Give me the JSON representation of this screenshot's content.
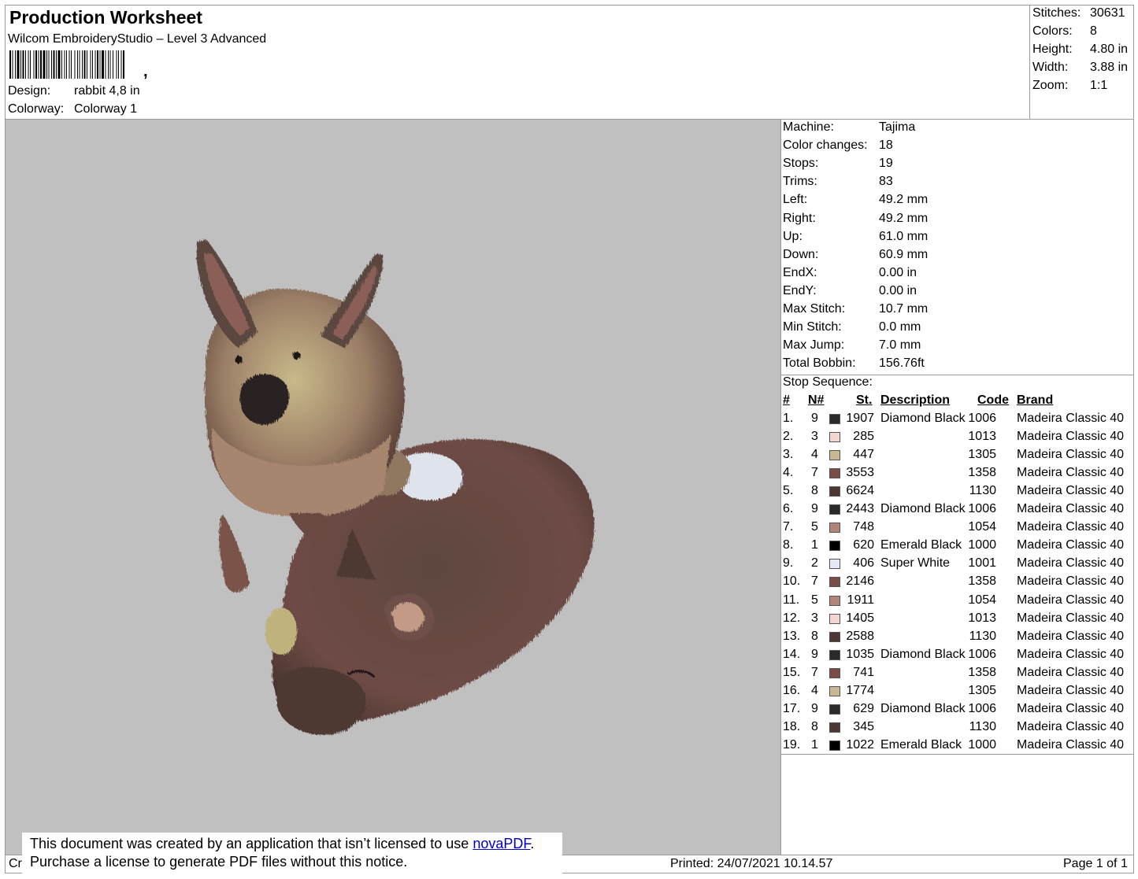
{
  "header": {
    "title": "Production Worksheet",
    "software": "Wilcom EmbroideryStudio – Level 3 Advanced",
    "barcode_suffix": ",",
    "design_label": "Design:",
    "design_value": "rabbit 4,8 in",
    "colorway_label": "Colorway:",
    "colorway_value": "Colorway 1"
  },
  "summary": [
    {
      "label": "Stitches:",
      "value": "30631"
    },
    {
      "label": "Colors:",
      "value": "8"
    },
    {
      "label": "Height:",
      "value": "4.80 in"
    },
    {
      "label": "Width:",
      "value": "3.88 in"
    },
    {
      "label": "Zoom:",
      "value": "1:1"
    }
  ],
  "machine_info": [
    {
      "label": "Machine:",
      "value": "Tajima"
    },
    {
      "label": "Color changes:",
      "value": "18"
    },
    {
      "label": "Stops:",
      "value": "19"
    },
    {
      "label": "Trims:",
      "value": "83"
    },
    {
      "label": "Left:",
      "value": "49.2 mm"
    },
    {
      "label": "Right:",
      "value": "49.2 mm"
    },
    {
      "label": "Up:",
      "value": "61.0 mm"
    },
    {
      "label": "Down:",
      "value": "60.9 mm"
    },
    {
      "label": "EndX:",
      "value": "0.00 in"
    },
    {
      "label": "EndY:",
      "value": "0.00 in"
    },
    {
      "label": "Max Stitch:",
      "value": "10.7 mm"
    },
    {
      "label": "Min Stitch:",
      "value": "0.0 mm"
    },
    {
      "label": "Max Jump:",
      "value": "7.0 mm"
    },
    {
      "label": "Total Bobbin:",
      "value": "156.76ft"
    }
  ],
  "stop_sequence": {
    "title": "Stop Sequence:",
    "headers": {
      "idx": "#",
      "n": "N#",
      "st": "St.",
      "desc": "Description",
      "code": "Code",
      "brand": "Brand"
    },
    "rows": [
      {
        "idx": "1.",
        "n": "9",
        "color": "#2a2a2a",
        "st": "1907",
        "desc": "Diamond Black",
        "code": "1006",
        "brand": "Madeira Classic 40"
      },
      {
        "idx": "2.",
        "n": "3",
        "color": "#f2d6cf",
        "st": "285",
        "desc": "",
        "code": "1013",
        "brand": "Madeira Classic 40"
      },
      {
        "idx": "3.",
        "n": "4",
        "color": "#c8b994",
        "st": "447",
        "desc": "",
        "code": "1305",
        "brand": "Madeira Classic 40"
      },
      {
        "idx": "4.",
        "n": "7",
        "color": "#7a4d47",
        "st": "3553",
        "desc": "",
        "code": "1358",
        "brand": "Madeira Classic 40"
      },
      {
        "idx": "5.",
        "n": "8",
        "color": "#4e3633",
        "st": "6624",
        "desc": "",
        "code": "1130",
        "brand": "Madeira Classic 40"
      },
      {
        "idx": "6.",
        "n": "9",
        "color": "#2a2a2a",
        "st": "2443",
        "desc": "Diamond Black",
        "code": "1006",
        "brand": "Madeira Classic 40"
      },
      {
        "idx": "7.",
        "n": "5",
        "color": "#b08478",
        "st": "748",
        "desc": "",
        "code": "1054",
        "brand": "Madeira Classic 40"
      },
      {
        "idx": "8.",
        "n": "1",
        "color": "#000000",
        "st": "620",
        "desc": "Emerald Black",
        "code": "1000",
        "brand": "Madeira Classic 40"
      },
      {
        "idx": "9.",
        "n": "2",
        "color": "#e6e8f8",
        "st": "406",
        "desc": "Super White",
        "code": "1001",
        "brand": "Madeira Classic 40"
      },
      {
        "idx": "10.",
        "n": "7",
        "color": "#7a4d47",
        "st": "2146",
        "desc": "",
        "code": "1358",
        "brand": "Madeira Classic 40"
      },
      {
        "idx": "11.",
        "n": "5",
        "color": "#b08478",
        "st": "1911",
        "desc": "",
        "code": "1054",
        "brand": "Madeira Classic 40"
      },
      {
        "idx": "12.",
        "n": "3",
        "color": "#f2d6cf",
        "st": "1405",
        "desc": "",
        "code": "1013",
        "brand": "Madeira Classic 40"
      },
      {
        "idx": "13.",
        "n": "8",
        "color": "#4e3633",
        "st": "2588",
        "desc": "",
        "code": "1130",
        "brand": "Madeira Classic 40"
      },
      {
        "idx": "14.",
        "n": "9",
        "color": "#2a2a2a",
        "st": "1035",
        "desc": "Diamond Black",
        "code": "1006",
        "brand": "Madeira Classic 40"
      },
      {
        "idx": "15.",
        "n": "7",
        "color": "#7a4d47",
        "st": "741",
        "desc": "",
        "code": "1358",
        "brand": "Madeira Classic 40"
      },
      {
        "idx": "16.",
        "n": "4",
        "color": "#c8b994",
        "st": "1774",
        "desc": "",
        "code": "1305",
        "brand": "Madeira Classic 40"
      },
      {
        "idx": "17.",
        "n": "9",
        "color": "#2a2a2a",
        "st": "629",
        "desc": "Diamond Black",
        "code": "1006",
        "brand": "Madeira Classic 40"
      },
      {
        "idx": "18.",
        "n": "8",
        "color": "#4e3633",
        "st": "345",
        "desc": "",
        "code": "1130",
        "brand": "Madeira Classic 40"
      },
      {
        "idx": "19.",
        "n": "1",
        "color": "#000000",
        "st": "1022",
        "desc": "Emerald Black",
        "code": "1000",
        "brand": "Madeira Classic 40"
      }
    ]
  },
  "footer": {
    "left_text": "Cr",
    "printed": "Printed: 24/07/2021 10.14.57",
    "page": "Page 1 of 1"
  },
  "notice": {
    "line1_prefix": "This document was created by an application that isn’t licensed to use ",
    "link": "novaPDF",
    "line1_suffix": ".",
    "line2": "Purchase a license to generate PDF files without this notice."
  }
}
